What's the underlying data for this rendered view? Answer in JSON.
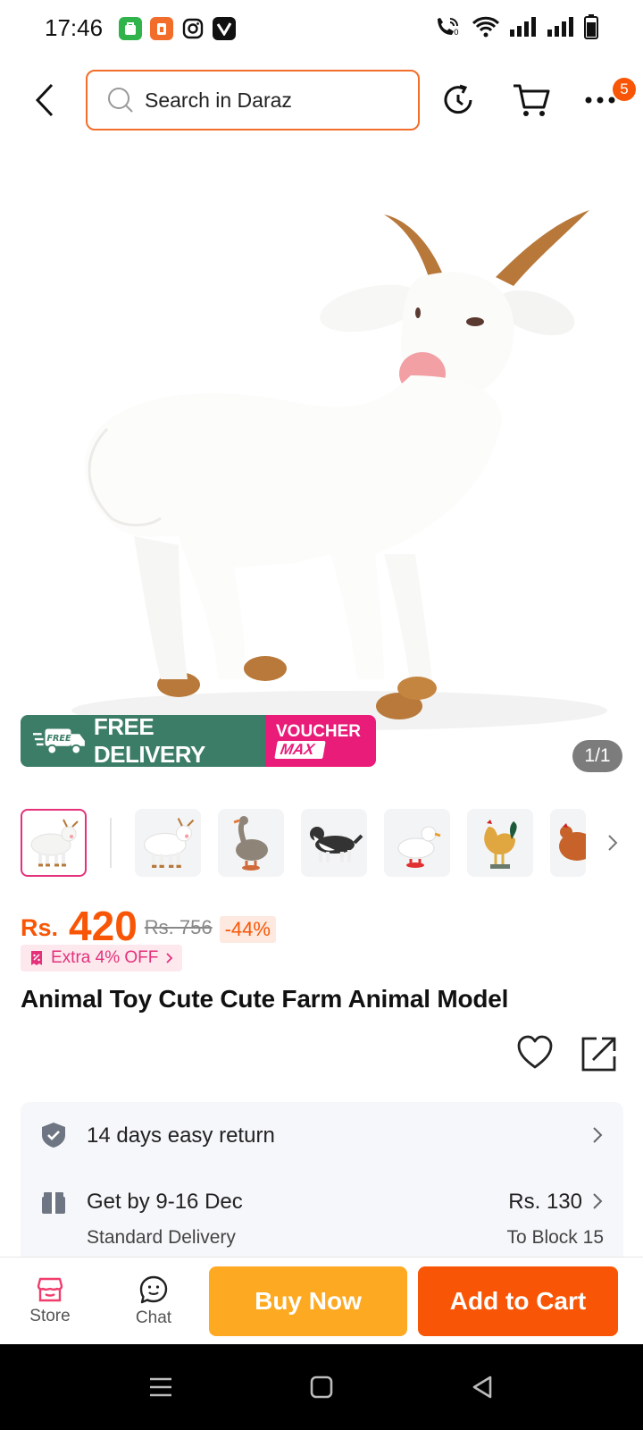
{
  "status_bar": {
    "time": "17:46",
    "app_icons": [
      "green-app-icon",
      "daraz-app-icon",
      "instagram-icon",
      "vimeo-icon"
    ],
    "right_icons": [
      "wifi-calling-icon",
      "wifi-icon",
      "signal-icon",
      "signal-icon",
      "battery-icon"
    ]
  },
  "header": {
    "search_placeholder": "Search in Daraz",
    "more_badge": "5",
    "accent": "#f36d2a"
  },
  "product": {
    "image_counter": "1/1",
    "promo": {
      "free_tag": "FREE",
      "free_delivery": "FREE DELIVERY",
      "voucher": "VOUCHER",
      "max": "MAX"
    },
    "thumbnails": [
      "goat",
      "goat",
      "goose",
      "dog",
      "duck",
      "rooster",
      "hen"
    ],
    "currency": "Rs.",
    "price": "420",
    "original_price": "Rs. 756",
    "discount": "-44%",
    "extra_offer": "Extra 4% OFF",
    "title": "Animal Toy Cute Cute Farm Animal Model"
  },
  "services": {
    "return_label": "14 days easy return",
    "delivery_label": "Get by 9-16 Dec",
    "delivery_sub": "Standard Delivery",
    "delivery_fee": "Rs. 130",
    "delivery_location": "To Block 15"
  },
  "action_bar": {
    "store_label": "Store",
    "chat_label": "Chat",
    "buy_now": "Buy Now",
    "add_to_cart": "Add to Cart",
    "colors": {
      "buy_now": "#fda921",
      "add_to_cart": "#f85606"
    }
  }
}
